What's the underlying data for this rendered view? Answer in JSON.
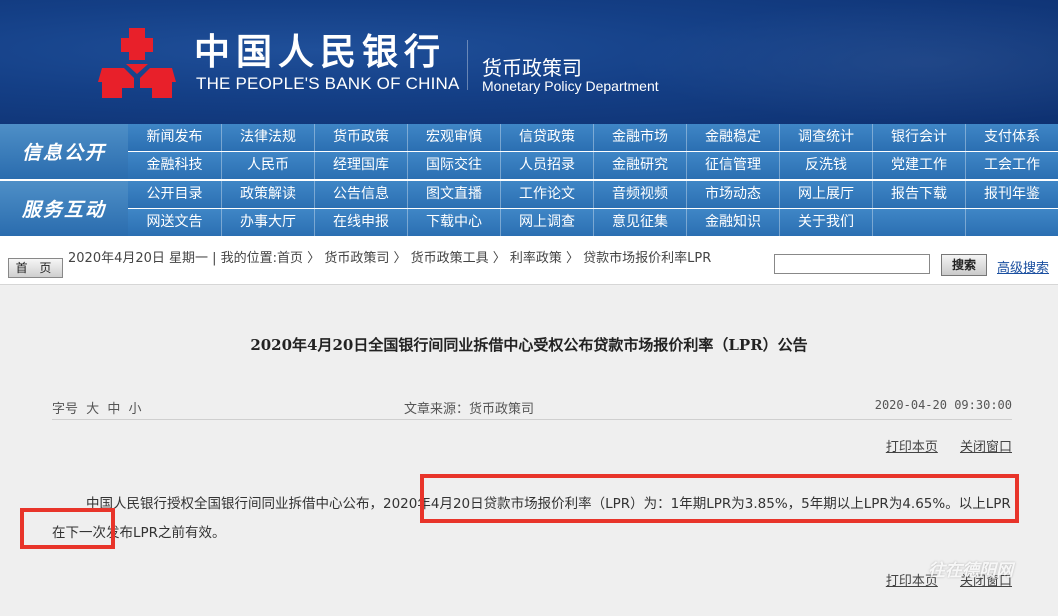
{
  "header": {
    "bank_cn": "中国人民银行",
    "bank_en": "THE PEOPLE'S BANK OF CHINA",
    "dept_cn": "货币政策司",
    "dept_en": "Monetary Policy Department",
    "emblem_icon": "pboc-emblem-icon",
    "bg_color": "#143f86"
  },
  "nav": {
    "info": {
      "label": "信息公开",
      "rows": [
        [
          "新闻发布",
          "法律法规",
          "货币政策",
          "宏观审慎",
          "信贷政策",
          "金融市场",
          "金融稳定",
          "调查统计",
          "银行会计",
          "支付体系"
        ],
        [
          "金融科技",
          "人民币",
          "经理国库",
          "国际交往",
          "人员招录",
          "金融研究",
          "征信管理",
          "反洗钱",
          "党建工作",
          "工会工作"
        ]
      ]
    },
    "service": {
      "label": "服务互动",
      "rows": [
        [
          "公开目录",
          "政策解读",
          "公告信息",
          "图文直播",
          "工作论文",
          "音频视频",
          "市场动态",
          "网上展厅",
          "报告下载",
          "报刊年鉴"
        ],
        [
          "网送文告",
          "办事大厅",
          "在线申报",
          "下载中心",
          "网上调查",
          "意见征集",
          "金融知识",
          "关于我们",
          "",
          ""
        ]
      ]
    }
  },
  "crumbbar": {
    "home_label": "首 页",
    "text": "2020年4月20日 星期一 | 我的位置:首页 〉 货币政策司 〉 货币政策工具 〉 利率政策 〉 贷款市场报价利率LPR",
    "search_placeholder": "",
    "search_label": "搜索",
    "advanced_label": "高级搜索"
  },
  "article": {
    "title": "2020年4月20日全国银行间同业拆借中心受权公布贷款市场报价利率（LPR）公告",
    "font_size_label": "字号",
    "font_sizes": [
      "大",
      "中",
      "小"
    ],
    "source": "文章来源：货币政策司",
    "time": "2020-04-20 09:30:00",
    "print_label": "打印本页",
    "close_label": "关闭窗口",
    "body": "中国人民银行授权全国银行间同业拆借中心公布，2020年4月20日贷款市场报价利率（LPR）为：1年期LPR为3.85%，5年期以上LPR为4.65%。以上LPR在下一次发布LPR之前有效。",
    "highlight_color": "#e8342a"
  },
  "watermark": "往在德阳网"
}
